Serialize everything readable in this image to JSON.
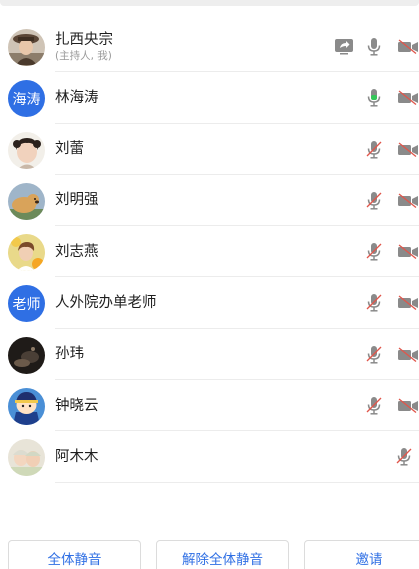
{
  "participants": [
    {
      "name": "扎西央宗",
      "role": "(主持人, 我)",
      "avatar_text": "",
      "avatar_icon": "photo-avatar-woman-hat",
      "sharing": true,
      "mic": "on-gray",
      "cam": "off"
    },
    {
      "name": "林海涛",
      "role": "",
      "avatar_text": "海涛",
      "avatar_icon": "",
      "sharing": false,
      "mic": "on-green",
      "cam": "off"
    },
    {
      "name": "刘蕾",
      "role": "",
      "avatar_text": "",
      "avatar_icon": "photo-avatar-girl",
      "sharing": false,
      "mic": "muted",
      "cam": "off"
    },
    {
      "name": "刘明强",
      "role": "",
      "avatar_text": "",
      "avatar_icon": "photo-avatar-dog",
      "sharing": false,
      "mic": "muted",
      "cam": "off"
    },
    {
      "name": "刘志燕",
      "role": "",
      "avatar_text": "",
      "avatar_icon": "photo-avatar-flowers",
      "sharing": false,
      "mic": "muted",
      "cam": "off"
    },
    {
      "name": "人外院办单老师",
      "role": "",
      "avatar_text": "老师",
      "avatar_icon": "",
      "sharing": false,
      "mic": "muted",
      "cam": "off"
    },
    {
      "name": "孙玮",
      "role": "",
      "avatar_text": "",
      "avatar_icon": "photo-avatar-dark",
      "sharing": false,
      "mic": "muted",
      "cam": "off"
    },
    {
      "name": "钟晓云",
      "role": "",
      "avatar_text": "",
      "avatar_icon": "cartoon-avatar",
      "sharing": false,
      "mic": "muted",
      "cam": "off"
    },
    {
      "name": "阿木木",
      "role": "",
      "avatar_text": "",
      "avatar_icon": "photo-avatar-baby",
      "sharing": false,
      "mic": "muted",
      "cam": "none"
    }
  ],
  "actions": {
    "mute_all": "全体静音",
    "unmute_all": "解除全体静音",
    "invite": "邀请"
  },
  "colors": {
    "accent": "#2f6fe4",
    "mic_on": "#34c759",
    "muted_red": "#e0564b",
    "icon_gray": "#8a8a8a"
  }
}
